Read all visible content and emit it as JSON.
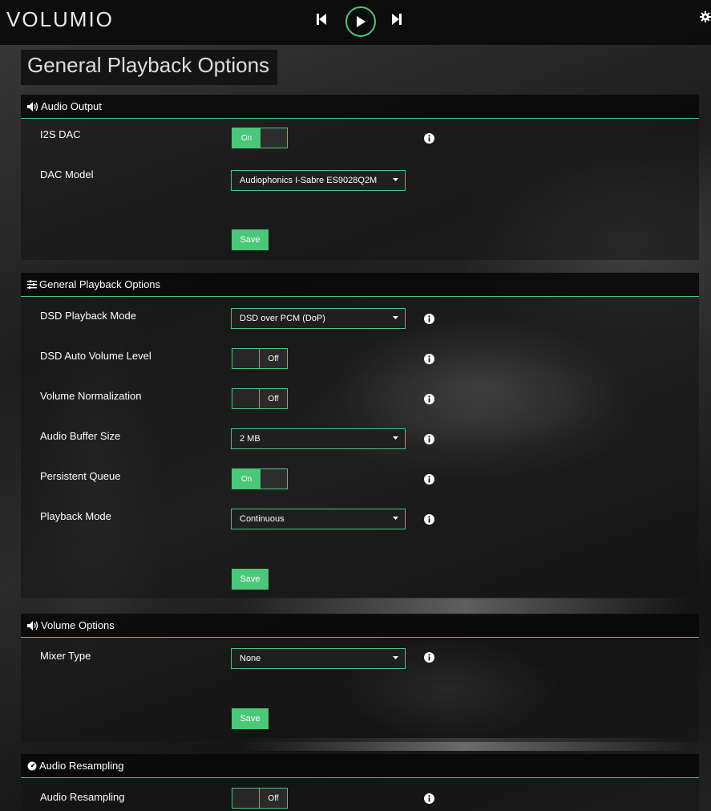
{
  "app": {
    "logo": "VOLUMIO"
  },
  "page": {
    "title": "General Playback Options"
  },
  "colors": {
    "accent": "#4bc779",
    "bar": "#0a0a0a"
  },
  "icons": {
    "prev": "skip-previous-icon",
    "play": "play-icon",
    "next": "skip-next-icon",
    "settings": "gear-icon",
    "info": "info-icon",
    "volume": "volume-icon",
    "sliders": "sliders-icon",
    "dashboard": "dashboard-icon",
    "caret": "caret-down-icon"
  },
  "sections": {
    "audio_output": {
      "title": "Audio Output",
      "i2s_label": "I2S DAC",
      "i2s_value": "On",
      "dac_label": "DAC Model",
      "dac_value": "Audiophonics I-Sabre ES9028Q2M",
      "save": "Save"
    },
    "general": {
      "title": "General Playback Options",
      "dsd_mode_label": "DSD Playback Mode",
      "dsd_mode_value": "DSD over PCM (DoP)",
      "dsd_auto_label": "DSD Auto Volume Level",
      "dsd_auto_value": "Off",
      "norm_label": "Volume Normalization",
      "norm_value": "Off",
      "buffer_label": "Audio Buffer Size",
      "buffer_value": "2 MB",
      "queue_label": "Persistent Queue",
      "queue_value": "On",
      "mode_label": "Playback Mode",
      "mode_value": "Continuous",
      "save": "Save"
    },
    "volume": {
      "title": "Volume Options",
      "mixer_label": "Mixer Type",
      "mixer_value": "None",
      "save": "Save"
    },
    "resampling": {
      "title": "Audio Resampling",
      "resampling_label": "Audio Resampling",
      "resampling_value": "Off"
    }
  }
}
